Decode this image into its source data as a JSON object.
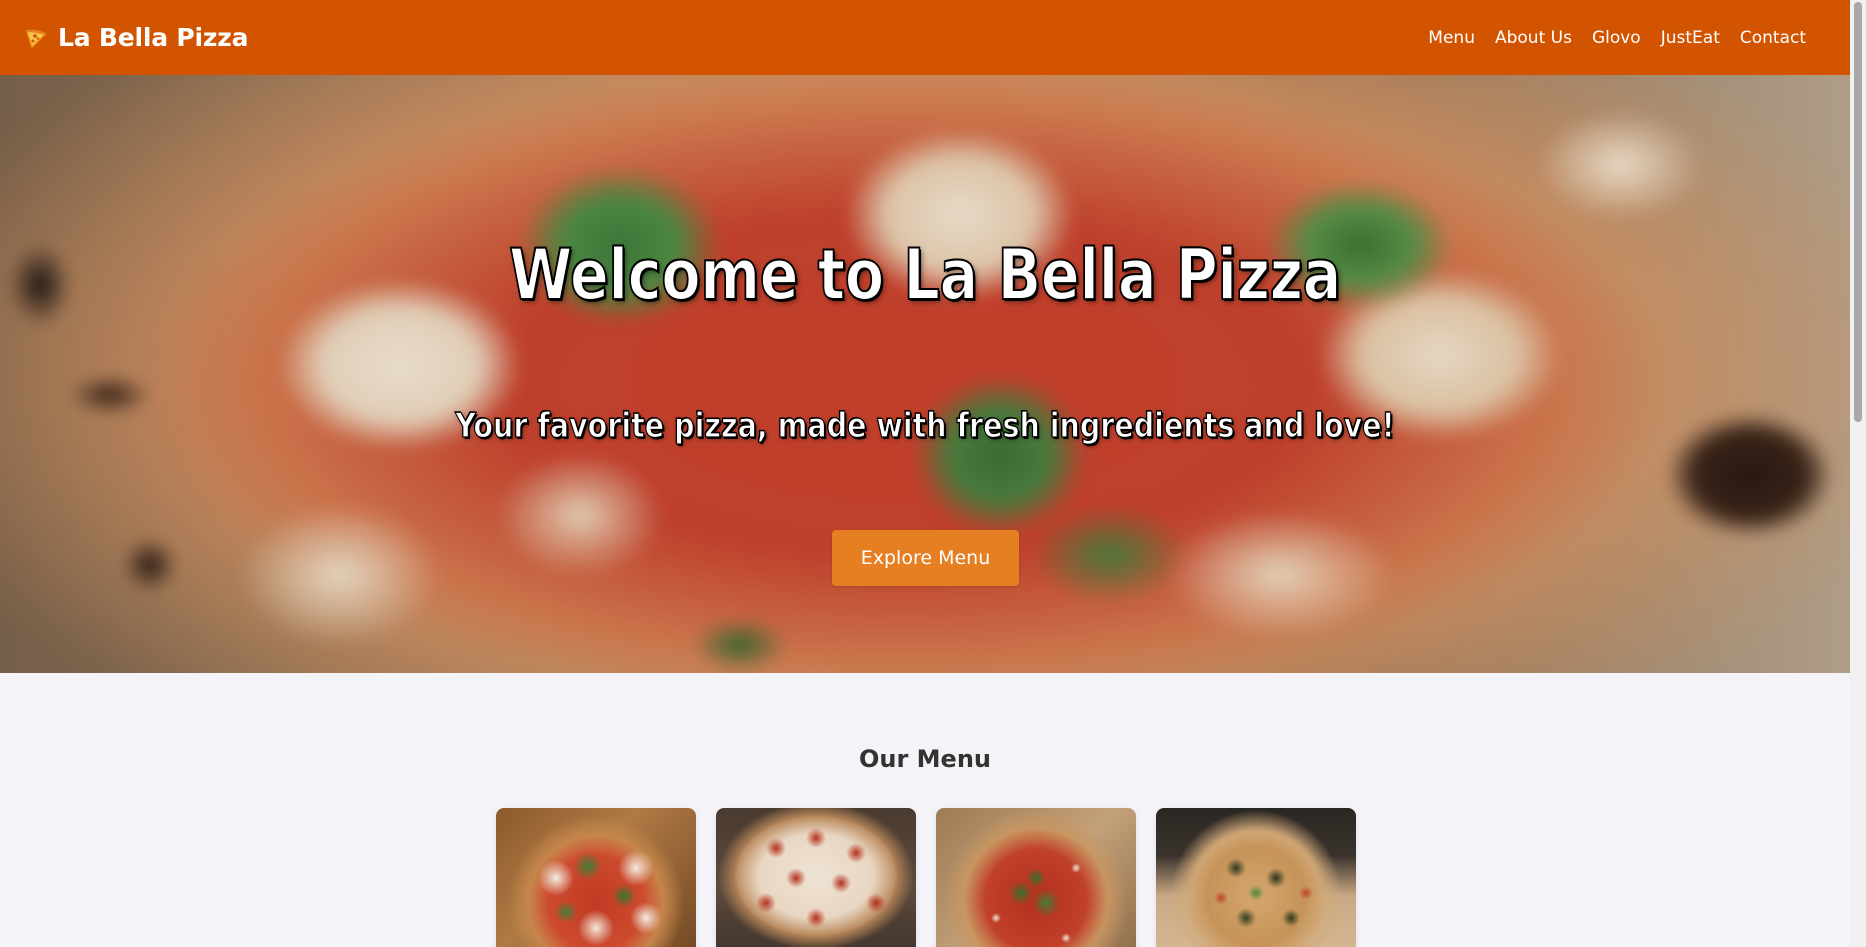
{
  "header": {
    "brand": "La Bella Pizza",
    "brand_icon": "pizza-slice-icon",
    "nav": [
      {
        "label": "Menu"
      },
      {
        "label": "About Us"
      },
      {
        "label": "Glovo"
      },
      {
        "label": "JustEat"
      },
      {
        "label": "Contact"
      }
    ]
  },
  "hero": {
    "title": "Welcome to La Bella Pizza",
    "subtitle": "Your favorite pizza, made with fresh ingredients and love!",
    "cta_label": "Explore Menu"
  },
  "menu": {
    "title": "Our Menu",
    "items": [
      {
        "image": "margherita-pizza"
      },
      {
        "image": "pepperoni-pizza"
      },
      {
        "image": "marinara-pizza"
      },
      {
        "image": "vegetable-pizza"
      }
    ]
  },
  "colors": {
    "header_bg": "#d35400",
    "button_bg": "#e67e22",
    "page_bg": "#f4f4f8"
  }
}
